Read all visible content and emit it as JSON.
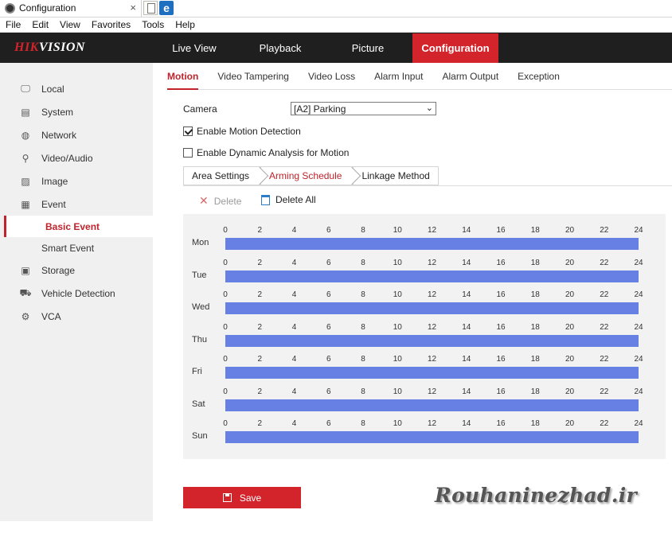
{
  "browser": {
    "tab_title": "Configuration",
    "tab_close": "×",
    "menu": [
      "File",
      "Edit",
      "View",
      "Favorites",
      "Tools",
      "Help"
    ]
  },
  "header": {
    "logo_part1": "HIK",
    "logo_part2": "VISION",
    "nav": [
      "Live View",
      "Playback",
      "Picture",
      "Configuration"
    ],
    "active_nav": "Configuration"
  },
  "sidebar": {
    "items": [
      {
        "label": "Local",
        "icon": "monitor-icon"
      },
      {
        "label": "System",
        "icon": "system-icon"
      },
      {
        "label": "Network",
        "icon": "globe-icon"
      },
      {
        "label": "Video/Audio",
        "icon": "microphone-icon"
      },
      {
        "label": "Image",
        "icon": "image-icon"
      },
      {
        "label": "Event",
        "icon": "calendar-icon"
      }
    ],
    "event_sub": [
      "Basic Event",
      "Smart Event"
    ],
    "active_sub": "Basic Event",
    "items_after": [
      {
        "label": "Storage",
        "icon": "storage-icon"
      },
      {
        "label": "Vehicle Detection",
        "icon": "vehicle-icon"
      },
      {
        "label": "VCA",
        "icon": "vca-icon"
      }
    ]
  },
  "tabs": [
    "Motion",
    "Video Tampering",
    "Video Loss",
    "Alarm Input",
    "Alarm Output",
    "Exception"
  ],
  "active_tab": "Motion",
  "form": {
    "camera_label": "Camera",
    "camera_value": "[A2] Parking",
    "enable_motion_label": "Enable Motion Detection",
    "enable_motion_checked": true,
    "enable_dynamic_label": "Enable Dynamic Analysis for Motion",
    "enable_dynamic_checked": false
  },
  "steps": [
    "Area Settings",
    "Arming Schedule",
    "Linkage Method"
  ],
  "active_step": "Arming Schedule",
  "toolbar": {
    "delete_label": "Delete",
    "delete_all_label": "Delete All"
  },
  "schedule": {
    "days": [
      "Mon",
      "Tue",
      "Wed",
      "Thu",
      "Fri",
      "Sat",
      "Sun"
    ],
    "hour_labels": [
      "0",
      "2",
      "4",
      "6",
      "8",
      "10",
      "12",
      "14",
      "16",
      "18",
      "20",
      "22",
      "24"
    ],
    "armed_start_hour": 0,
    "armed_end_hour": 24,
    "bar_color": "#6680e4"
  },
  "save_label": "Save",
  "watermark": "Rouhaninezhad.ir",
  "colors": {
    "accent": "#d3232b"
  }
}
